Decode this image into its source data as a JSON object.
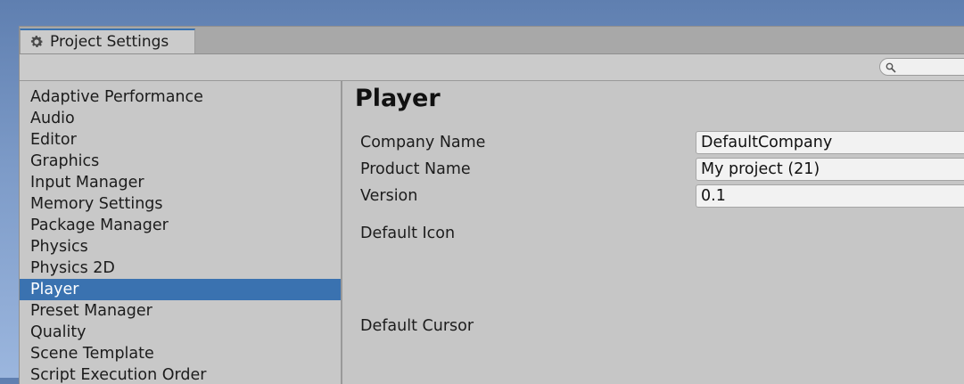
{
  "window": {
    "tab_title": "Project Settings",
    "tab_icon": "gear-icon"
  },
  "search": {
    "icon": "search-icon",
    "value": ""
  },
  "sidebar": {
    "selected": "Player",
    "items": [
      {
        "label": "Adaptive Performance"
      },
      {
        "label": "Audio"
      },
      {
        "label": "Editor"
      },
      {
        "label": "Graphics"
      },
      {
        "label": "Input Manager"
      },
      {
        "label": "Memory Settings"
      },
      {
        "label": "Package Manager"
      },
      {
        "label": "Physics"
      },
      {
        "label": "Physics 2D"
      },
      {
        "label": "Player"
      },
      {
        "label": "Preset Manager"
      },
      {
        "label": "Quality"
      },
      {
        "label": "Scene Template"
      },
      {
        "label": "Script Execution Order"
      }
    ]
  },
  "main": {
    "title": "Player",
    "fields": [
      {
        "label": "Company Name",
        "value": "DefaultCompany"
      },
      {
        "label": "Product Name",
        "value": "My project (21)"
      },
      {
        "label": "Version",
        "value": "0.1"
      }
    ],
    "default_icon_label": "Default Icon",
    "default_cursor_label": "Default Cursor"
  },
  "colors": {
    "selection": "#3a72b0",
    "panel": "#c2c2c2"
  }
}
